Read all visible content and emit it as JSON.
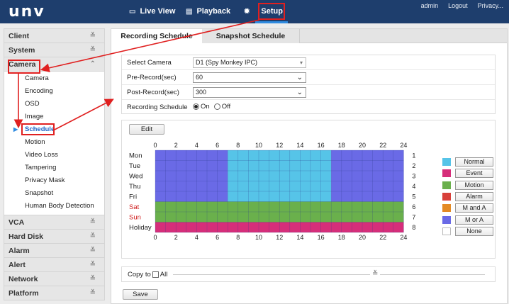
{
  "header": {
    "logo": "unv",
    "nav": [
      {
        "label": "Live View",
        "icon": "monitor-icon"
      },
      {
        "label": "Playback",
        "icon": "film-icon"
      },
      {
        "label": "Setup",
        "icon": "gear-icon"
      }
    ],
    "user": {
      "name": "admin",
      "logout": "Logout",
      "privacy": "Privacy..."
    }
  },
  "sidebar": {
    "sections_top": [
      {
        "label": "Client"
      },
      {
        "label": "System"
      },
      {
        "label": "Camera"
      }
    ],
    "camera_items": [
      "Camera",
      "Encoding",
      "OSD",
      "Image",
      "Schedule",
      "Motion",
      "Video Loss",
      "Tampering",
      "Privacy Mask",
      "Snapshot",
      "Human Body Detection"
    ],
    "selected_item": "Schedule",
    "sections_bottom": [
      {
        "label": "VCA"
      },
      {
        "label": "Hard Disk"
      },
      {
        "label": "Alarm"
      },
      {
        "label": "Alert"
      },
      {
        "label": "Network"
      },
      {
        "label": "Platform"
      }
    ]
  },
  "tabs": [
    "Recording Schedule",
    "Snapshot Schedule"
  ],
  "form": {
    "select_camera_label": "Select Camera",
    "select_camera_value": "D1 (Spy Monkey IPC)",
    "pre_record_label": "Pre-Record(sec)",
    "pre_record_value": "60",
    "post_record_label": "Post-Record(sec)",
    "post_record_value": "300",
    "recording_schedule_label": "Recording Schedule",
    "on_label": "On",
    "off_label": "Off",
    "recording_on": true
  },
  "schedule": {
    "edit_label": "Edit",
    "hour_ticks": [
      "0",
      "2",
      "4",
      "6",
      "8",
      "10",
      "12",
      "14",
      "16",
      "18",
      "20",
      "22",
      "24"
    ],
    "days": [
      {
        "label": "Mon",
        "num": "1",
        "weekend": false
      },
      {
        "label": "Tue",
        "num": "2",
        "weekend": false
      },
      {
        "label": "Wed",
        "num": "3",
        "weekend": false
      },
      {
        "label": "Thu",
        "num": "4",
        "weekend": false
      },
      {
        "label": "Fri",
        "num": "5",
        "weekend": false
      },
      {
        "label": "Sat",
        "num": "6",
        "weekend": true
      },
      {
        "label": "Sun",
        "num": "7",
        "weekend": true
      },
      {
        "label": "Holiday",
        "num": "8",
        "weekend": false
      }
    ],
    "rows": [
      [
        {
          "from": 0,
          "to": 7,
          "type": "M or A"
        },
        {
          "from": 7,
          "to": 17,
          "type": "Normal"
        },
        {
          "from": 17,
          "to": 24,
          "type": "M or A"
        }
      ],
      [
        {
          "from": 0,
          "to": 7,
          "type": "M or A"
        },
        {
          "from": 7,
          "to": 17,
          "type": "Normal"
        },
        {
          "from": 17,
          "to": 24,
          "type": "M or A"
        }
      ],
      [
        {
          "from": 0,
          "to": 7,
          "type": "M or A"
        },
        {
          "from": 7,
          "to": 17,
          "type": "Normal"
        },
        {
          "from": 17,
          "to": 24,
          "type": "M or A"
        }
      ],
      [
        {
          "from": 0,
          "to": 7,
          "type": "M or A"
        },
        {
          "from": 7,
          "to": 17,
          "type": "Normal"
        },
        {
          "from": 17,
          "to": 24,
          "type": "M or A"
        }
      ],
      [
        {
          "from": 0,
          "to": 7,
          "type": "M or A"
        },
        {
          "from": 7,
          "to": 17,
          "type": "Normal"
        },
        {
          "from": 17,
          "to": 24,
          "type": "M or A"
        }
      ],
      [
        {
          "from": 0,
          "to": 24,
          "type": "Motion"
        }
      ],
      [
        {
          "from": 0,
          "to": 24,
          "type": "Motion"
        }
      ],
      [
        {
          "from": 0,
          "to": 24,
          "type": "Event"
        }
      ]
    ],
    "legend": [
      {
        "label": "Normal",
        "color": "#56c4e8"
      },
      {
        "label": "Event",
        "color": "#d62e7a"
      },
      {
        "label": "Motion",
        "color": "#6ab04c"
      },
      {
        "label": "Alarm",
        "color": "#d8403a"
      },
      {
        "label": "M and A",
        "color": "#e48a24"
      },
      {
        "label": "M or A",
        "color": "#6a6ae6"
      },
      {
        "label": "None",
        "color": "#ffffff"
      }
    ]
  },
  "copy": {
    "label": "Copy to",
    "all_label": "All"
  },
  "save_label": "Save",
  "colors": {
    "header_bg": "#1e3e6d",
    "accent": "#2f8be0",
    "annotation": "#e02020",
    "weekend_text": "#d02020"
  }
}
